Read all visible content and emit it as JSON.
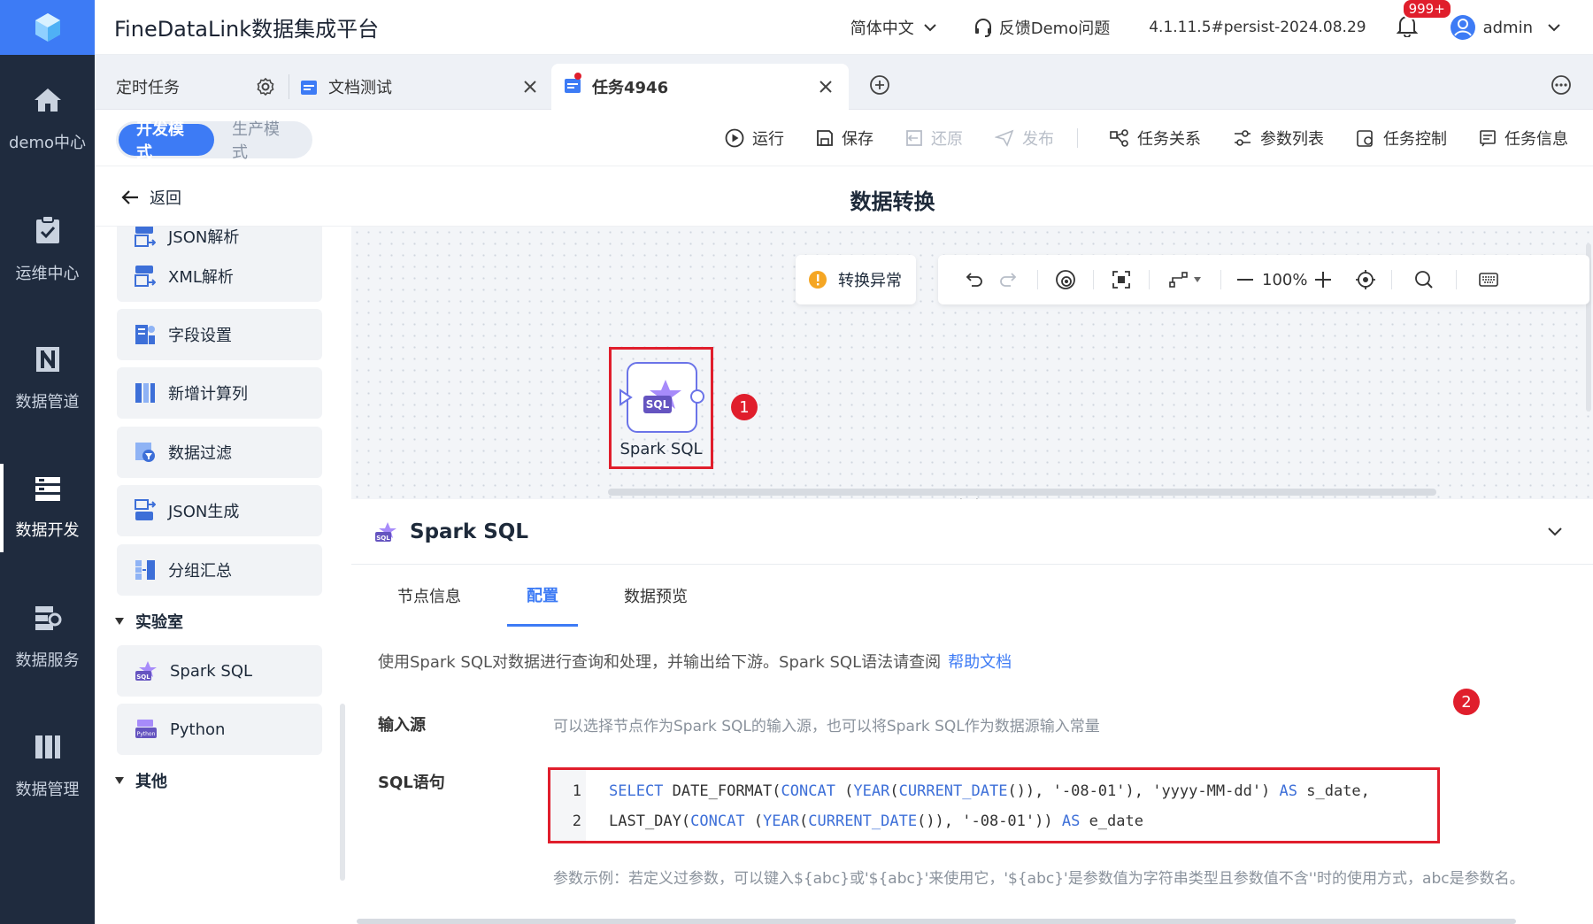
{
  "app": {
    "title": "FineDataLink数据集成平台",
    "language": "简体中文",
    "feedback": "反馈Demo问题",
    "version": "4.1.11.5#persist-2024.08.29",
    "notif_count": "999+",
    "user": "admin"
  },
  "nav": {
    "items": [
      {
        "label": "demo中心",
        "icon": "home-icon"
      },
      {
        "label": "运维中心",
        "icon": "clipboard-check-icon"
      },
      {
        "label": "数据管道",
        "icon": "pipeline-icon"
      },
      {
        "label": "数据开发",
        "icon": "server-stack-icon"
      },
      {
        "label": "数据服务",
        "icon": "service-icon"
      },
      {
        "label": "数据管理",
        "icon": "management-icon"
      }
    ]
  },
  "tabs": [
    {
      "label": "定时任务"
    },
    {
      "label": "文档测试"
    },
    {
      "label": "任务4946"
    }
  ],
  "modes": {
    "dev": "开发模式",
    "prod": "生产模式"
  },
  "toolbar": {
    "run": "运行",
    "save": "保存",
    "restore": "还原",
    "publish": "发布",
    "relation": "任务关系",
    "params": "参数列表",
    "control": "任务控制",
    "info": "任务信息"
  },
  "subheader": {
    "back": "返回",
    "title": "数据转换"
  },
  "operators": {
    "items": [
      "JSON解析",
      "XML解析",
      "字段设置",
      "新增计算列",
      "数据过滤",
      "JSON生成",
      "分组汇总"
    ],
    "lab_title": "实验室",
    "lab_items": [
      "Spark SQL",
      "Python"
    ],
    "other_title": "其他"
  },
  "canvas": {
    "warning": "转换异常",
    "zoom": "100%",
    "node_label": "Spark SQL",
    "badge1": "1",
    "badge2": "2"
  },
  "properties": {
    "title": "Spark SQL",
    "tabs": [
      "节点信息",
      "配置",
      "数据预览"
    ],
    "description": "使用Spark SQL对数据进行查询和处理，并输出给下游。Spark SQL语法请查阅",
    "help_link": "帮助文档",
    "input_label": "输入源",
    "input_hint": "可以选择节点作为Spark SQL的输入源，也可以将Spark SQL作为数据源输入常量",
    "sql_label": "SQL语句",
    "sql_lines": [
      "SELECT DATE_FORMAT(CONCAT (YEAR(CURRENT_DATE()), '-08-01'), 'yyyy-MM-dd') AS s_date,",
      "LAST_DAY(CONCAT (YEAR(CURRENT_DATE()), '-08-01')) AS e_date"
    ],
    "param_hint": "参数示例：若定义过参数，可以键入${abc}或'${abc}'来使用它，'${abc}'是参数值为字符串类型且参数值不含''时的使用方式，abc是参数名。"
  },
  "colors": {
    "accent": "#3d7bf5",
    "sidebar": "#1f2b3e",
    "highlight": "#e01e2c"
  }
}
